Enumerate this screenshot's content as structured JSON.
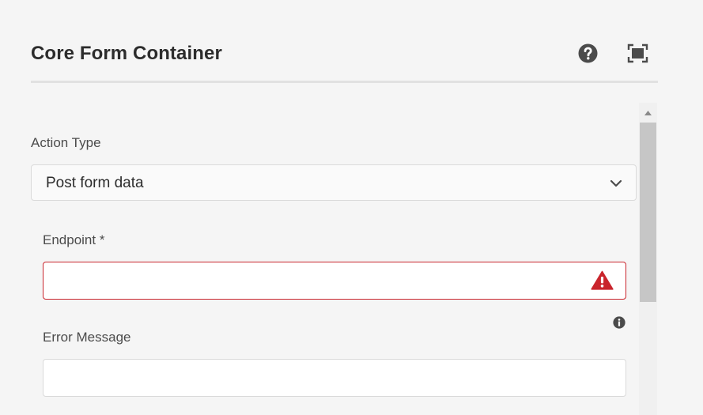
{
  "dialog": {
    "title": "Core Form Container",
    "header_icons": {
      "help": "help-question-icon",
      "fullscreen": "fullscreen-icon"
    }
  },
  "form": {
    "action_type": {
      "label": "Action Type",
      "selected": "Post form data",
      "icon": "chevron-down-icon"
    },
    "endpoint": {
      "label": "Endpoint *",
      "value": "",
      "invalid": true,
      "status_icon": "alert-triangle-icon"
    },
    "error_message": {
      "label": "Error Message",
      "value": "",
      "info_icon": "info-icon"
    }
  },
  "colors": {
    "background": "#f5f5f5",
    "error": "#c9252d",
    "icon_dark": "#4b4b4b",
    "scrollbar_thumb": "#c6c6c6"
  }
}
